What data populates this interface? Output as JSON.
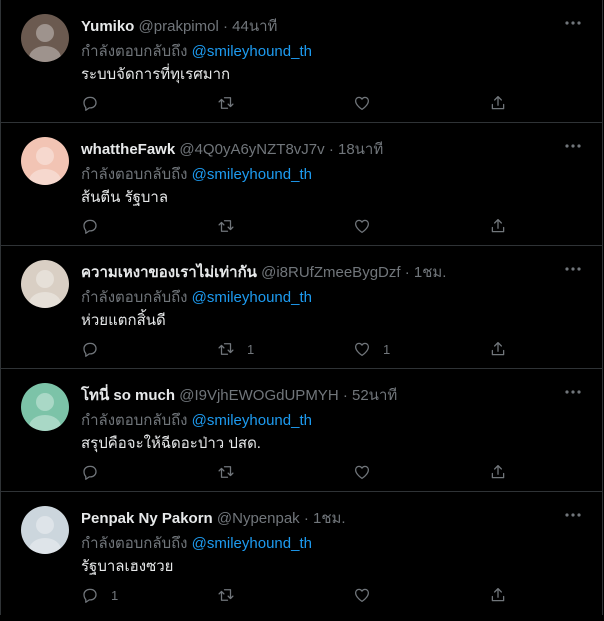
{
  "tweets": [
    {
      "name": "Yumiko",
      "handle": "@prakpimol",
      "dot": "·",
      "time": "44นาที",
      "reply_prefix": "กำลังตอบกลับถึง",
      "mention": "@smileyhound_th",
      "text": "ระบบจัดการที่ทุเรศมาก",
      "replies": "",
      "retweets": "",
      "likes": "",
      "avatar_color": "#6b5a50"
    },
    {
      "name": "whattheFawk",
      "handle": "@4Q0yA6yNZT8vJ7v",
      "dot": "·",
      "time": "18นาที",
      "reply_prefix": "กำลังตอบกลับถึง",
      "mention": "@smileyhound_th",
      "text": "ส้นตีน รัฐบาล",
      "replies": "",
      "retweets": "",
      "likes": "",
      "avatar_color": "#f2c4b4"
    },
    {
      "name": "ความเหงาของเราไม่เท่ากัน",
      "handle": "@i8RUfZmeeBygDzf",
      "dot": "·",
      "time": "1ชม.",
      "reply_prefix": "กำลังตอบกลับถึง",
      "mention": "@smileyhound_th",
      "text": "ห่วยแตกสิ้นดี",
      "replies": "",
      "retweets": "1",
      "likes": "1",
      "avatar_color": "#d9cfc4"
    },
    {
      "name": "โทนี่ so much",
      "handle": "@I9VjhEWOGdUPMYH",
      "dot": "·",
      "time": "52นาที",
      "reply_prefix": "กำลังตอบกลับถึง",
      "mention": "@smileyhound_th",
      "text": "สรุปคือจะให้ฉีดอะป่าว ปสด.",
      "replies": "",
      "retweets": "",
      "likes": "",
      "avatar_color": "#7cc3a8"
    },
    {
      "name": "Penpak Ny Pakorn",
      "handle": "@Nypenpak",
      "dot": "·",
      "time": "1ชม.",
      "reply_prefix": "กำลังตอบกลับถึง",
      "mention": "@smileyhound_th",
      "text": "รัฐบาลเฮงซวย",
      "replies": "1",
      "retweets": "",
      "likes": "",
      "avatar_color": "#ccd6dd"
    }
  ],
  "colors": {
    "accent": "#1d9bf0",
    "muted": "#71767b",
    "text": "#e7e9ea",
    "background": "#000000"
  },
  "icons": {
    "reply": "reply-icon",
    "retweet": "retweet-icon",
    "like": "heart-icon",
    "share": "share-icon",
    "more": "more-icon"
  }
}
